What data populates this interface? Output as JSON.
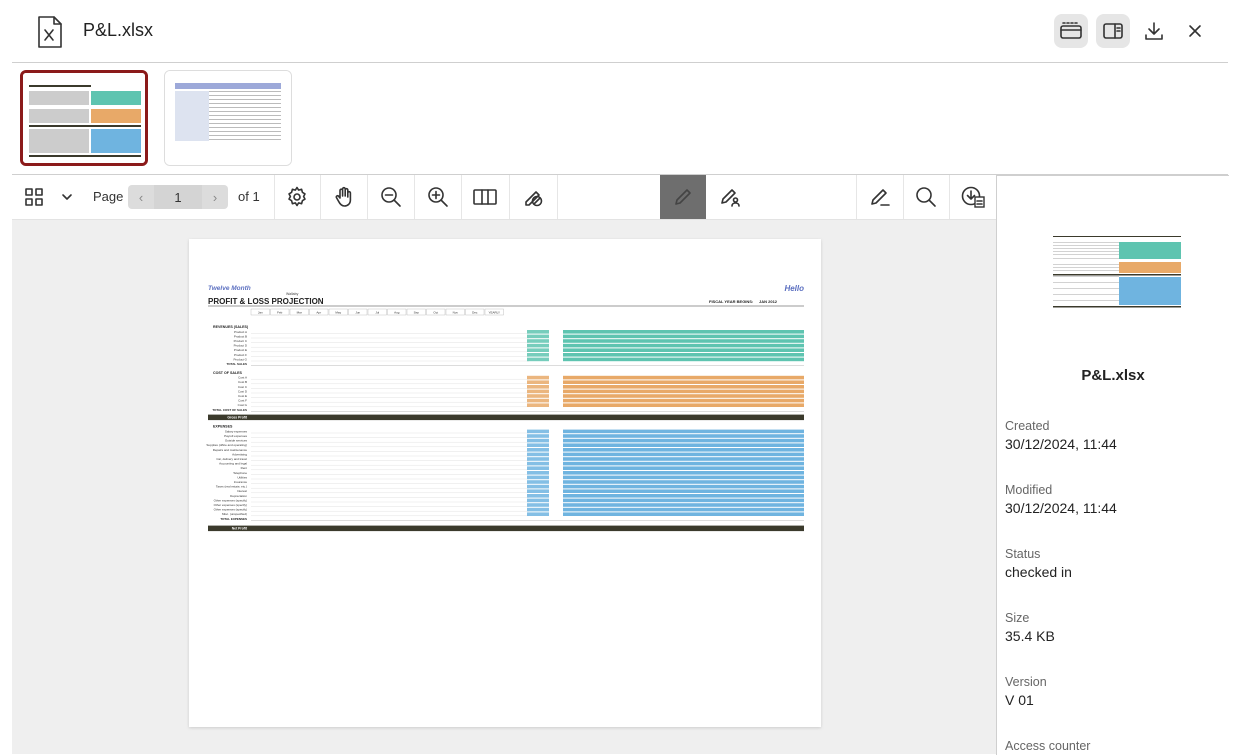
{
  "header": {
    "file_name": "P&L.xlsx",
    "icons": [
      "xlsx-file-icon",
      "thumbnails-view-icon",
      "side-panel-icon",
      "download-icon",
      "close-icon"
    ]
  },
  "toolbar": {
    "page_label": "Page",
    "page_value": "1",
    "of_label": "of 1",
    "icons": [
      "grid-icon",
      "chevron-down-icon",
      "settings-icon",
      "hand-icon",
      "zoom-out-icon",
      "zoom-in-icon",
      "columns-icon",
      "eraser-off-icon",
      "pencil-icon",
      "sign-icon",
      "annotate-icon",
      "search-icon",
      "download-pdf-icon"
    ]
  },
  "document": {
    "subtitle": "Twelve Month",
    "title": "PROFIT & LOSS PROJECTION",
    "brand": "Hello",
    "small_brand": "Wallaby",
    "fiscal_label": "FISCAL YEAR BEGINS:",
    "fiscal_value": "JAN 2012",
    "months": [
      "Jan",
      "Feb",
      "Mar",
      "Apr",
      "May",
      "Jun",
      "Jul",
      "Aug",
      "Sep",
      "Oct",
      "Nov",
      "Dec",
      "YEARLY"
    ],
    "sections": {
      "revenues": "REVENUES (SALES)",
      "cost": "COST OF SALES",
      "expenses": "EXPENSES"
    },
    "revenue_rows": [
      "Product A",
      "Product B",
      "Product C",
      "Product D",
      "Product E",
      "Product F",
      "Product G"
    ],
    "revenue_total": "TOTAL SALES",
    "cost_rows": [
      "Cost A",
      "Cost B",
      "Cost C",
      "Cost D",
      "Cost E",
      "Cost F",
      "Cost G"
    ],
    "cost_total": "TOTAL COST OF SALES",
    "gross_profit": "Gross Profit",
    "expense_rows": [
      "Salary expenses",
      "Payroll expenses",
      "Outside services",
      "Supplies (office and operating)",
      "Repairs and maintenance",
      "Advertising",
      "Car, delivery and travel",
      "Accounting and legal",
      "Rent",
      "Telephone",
      "Utilities",
      "Insurance",
      "Taxes (real estate, etc.)",
      "Interest",
      "Depreciation",
      "Other expenses (specify)",
      "Other expenses (specify)",
      "Other expenses (specify)",
      "Misc. (unspecified)"
    ],
    "expense_total": "TOTAL EXPENSES",
    "net_profit": "Net Profit"
  },
  "sidebar": {
    "file_name": "P&L.xlsx",
    "created_label": "Created",
    "created_value": "30/12/2024, 11:44",
    "modified_label": "Modified",
    "modified_value": "30/12/2024, 11:44",
    "status_label": "Status",
    "status_value": "checked in",
    "size_label": "Size",
    "size_value": "35.4 KB",
    "version_label": "Version",
    "version_value": "V 01",
    "access_label": "Access counter"
  },
  "colors": {
    "teal": "#5ec4b0",
    "orange": "#e8a968",
    "blue": "#6fb4e0",
    "dark_band": "#3b3a2c",
    "selected_border": "#8b1a1a",
    "accent_blue": "#5b6fc0"
  }
}
